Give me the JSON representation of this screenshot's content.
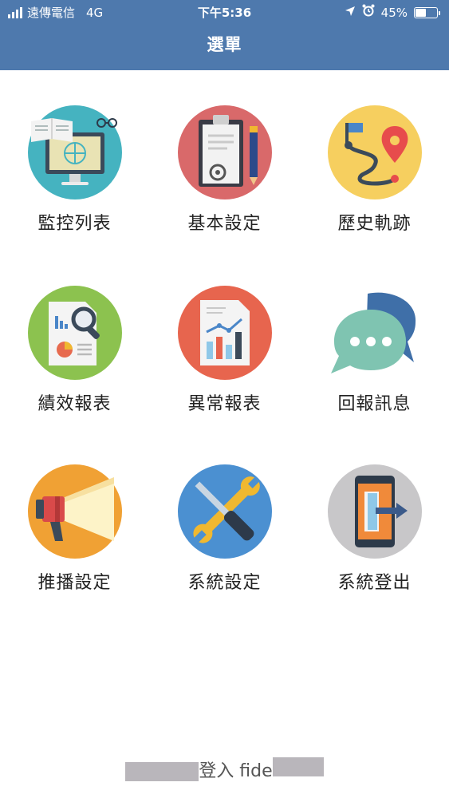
{
  "status_bar": {
    "carrier": "遠傳電信",
    "network": "4G",
    "time": "下午5:36",
    "battery": "45%",
    "battery_level": 0.45
  },
  "header": {
    "title": "選單"
  },
  "menu": {
    "items": [
      {
        "label": "監控列表",
        "icon": "computer-monitor-icon",
        "color": "#45b3c0"
      },
      {
        "label": "基本設定",
        "icon": "clipboard-settings-icon",
        "color": "#d9696a"
      },
      {
        "label": "歷史軌跡",
        "icon": "route-map-pin-icon",
        "color": "#f6cf5f"
      },
      {
        "label": "績效報表",
        "icon": "report-magnifier-icon",
        "color": "#8cc24f"
      },
      {
        "label": "異常報表",
        "icon": "bar-chart-document-icon",
        "color": "#e7654e"
      },
      {
        "label": "回報訊息",
        "icon": "chat-bubbles-icon",
        "color": "#7fc4b1"
      },
      {
        "label": "推播設定",
        "icon": "megaphone-icon",
        "color": "#f0a134"
      },
      {
        "label": "系統設定",
        "icon": "wrench-screwdriver-icon",
        "color": "#4b90d1"
      },
      {
        "label": "系統登出",
        "icon": "phone-logout-icon",
        "color": "#c8c7c9"
      }
    ]
  },
  "footer": {
    "login_text": "登入 fide"
  }
}
